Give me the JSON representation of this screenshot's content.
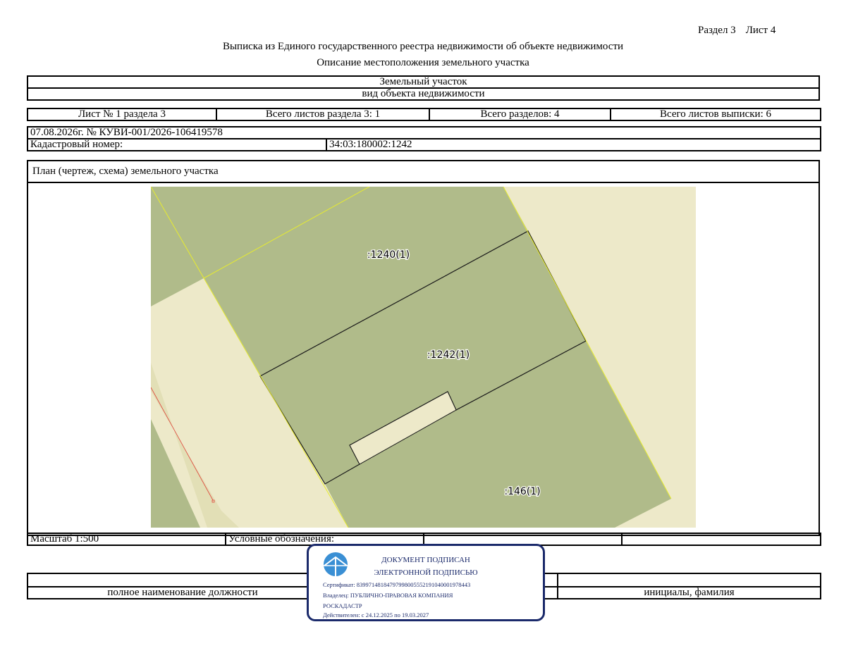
{
  "header": {
    "section": "Раздел 3",
    "sheet": "Лист 4"
  },
  "title": "Выписка из Единого государственного реестра недвижимости об объекте недвижимости",
  "subtitle": "Описание местоположения земельного участка",
  "object_type": {
    "value": "Земельный участок",
    "label": "вид объекта недвижимости"
  },
  "sheet_info": {
    "sheet_no": "Лист № 1 раздела 3",
    "total_sheets_section": "Всего листов раздела 3: 1",
    "total_sections": "Всего разделов: 4",
    "total_sheets_extract": "Всего листов выписки: 6"
  },
  "document": {
    "date_number": "07.08.2026г. № КУВИ-001/2026-106419578",
    "cadastral_label": "Кадастровый номер:",
    "cadastral_value": "34:03:180002:1242"
  },
  "plan": {
    "heading": "План (чертеж, схема) земельного участка",
    "parcels": [
      {
        "label": ":1240(1)"
      },
      {
        "label": ":1242(1)"
      },
      {
        "label": ":146(1)"
      }
    ],
    "colors": {
      "background": "#ede9c9",
      "parcel": "#b0bb8a",
      "boundary": "#1a1a1a",
      "adjacent_line": "#e7ec2f",
      "red_line": "#e0443a"
    }
  },
  "footer": {
    "scale": "Масштаб 1:500",
    "legend_label": "Условные обозначения:",
    "position_label": "полное наименование должности",
    "name_label": "инициалы, фамилия"
  },
  "stamp": {
    "line1": "ДОКУМЕНТ ПОДПИСАН",
    "line2": "ЭЛЕКТРОННОЙ ПОДПИСЬЮ",
    "certificate": "Сертификат: 83997148184797998005552191040001978443",
    "owner": "Владелец: ПУБЛИЧНО-ПРАВОВАЯ КОМПАНИЯ",
    "owner2": "РОСКАДАСТР",
    "valid": "Действителен: с 24.12.2025 по 19.03.2027",
    "color": "#1b2a6b",
    "logo_icon": "roskadastr-logo-icon"
  }
}
